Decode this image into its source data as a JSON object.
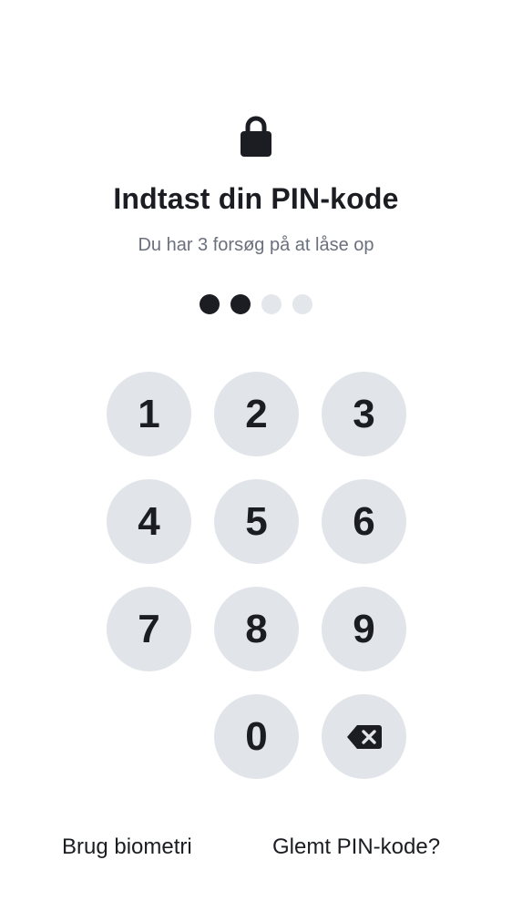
{
  "header": {
    "icon": "lock-icon",
    "title": "Indtast din PIN-kode",
    "subtitle": "Du har 3 forsøg på at låse op"
  },
  "pin": {
    "length": 4,
    "entered": 2
  },
  "keypad": {
    "keys": [
      "1",
      "2",
      "3",
      "4",
      "5",
      "6",
      "7",
      "8",
      "9",
      "0"
    ],
    "backspace_icon": "backspace-icon"
  },
  "footer": {
    "biometric_label": "Brug biometri",
    "forgot_label": "Glemt PIN-kode?"
  },
  "colors": {
    "text": "#1b1d22",
    "subtle_text": "#6a707c",
    "key_background": "#e1e5ea",
    "dot_empty": "#e3e6eb",
    "dot_filled": "#1b1d22"
  }
}
